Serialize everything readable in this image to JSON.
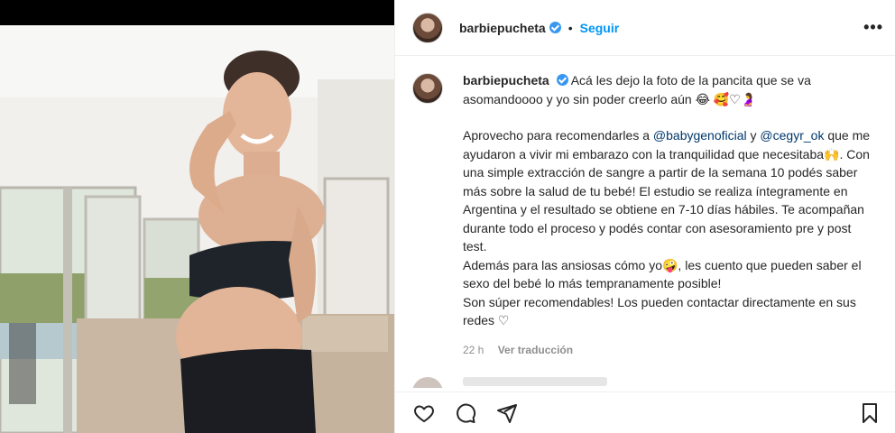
{
  "post": {
    "username": "barbiepucheta",
    "follow_label": "Seguir",
    "dot": "•",
    "more_label": "•••"
  },
  "caption": {
    "line1_username": "barbiepucheta",
    "line1_text": "Acá les dejo la foto de la pancita que se va asomandoooo y yo sin poder creerlo aún 😂 🥰♡🤰",
    "p2_a": "Aprovecho para recomendarles a ",
    "p2_link1": "@babygenoficial",
    "p2_b": " y ",
    "p2_link2": "@cegyr_ok",
    "p2_c": " que me ayudaron a vivir mi embarazo con la tranquilidad que necesitaba🙌. Con una simple extracción de sangre a partir de la semana 10 podés saber más sobre la salud de tu bebé! El estudio se realiza íntegramente en Argentina y el resultado se obtiene en 7-10 días hábiles. Te acompañan durante todo el proceso y podés contar con asesoramiento pre y post test.",
    "p3": "Además para las ansiosas cómo yo🤪, les cuento que pueden saber el sexo del bebé lo más tempranamente posible!",
    "p4": "Son súper recomendables! Los pueden contactar directamente en sus redes ♡"
  },
  "meta": {
    "time": "22 h",
    "translate": "Ver traducción"
  },
  "icons": {
    "like": "heart-icon",
    "comment": "comment-icon",
    "share": "share-icon",
    "save": "bookmark-icon"
  },
  "colors": {
    "accent": "#0095f6",
    "verified": "#3897f0",
    "link": "#00376b",
    "muted": "#8e8e8e"
  }
}
